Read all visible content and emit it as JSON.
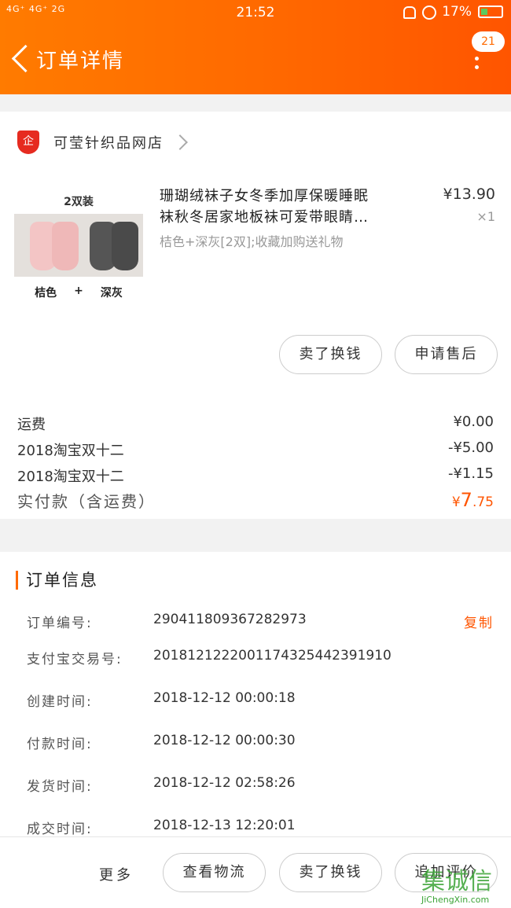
{
  "status_bar": {
    "network": "4G⁺ 4G⁺ 2G",
    "time": "21:52",
    "battery": "17%"
  },
  "header": {
    "title": "订单详情",
    "badge_count": "21"
  },
  "store": {
    "name": "可莹针织品网店"
  },
  "product": {
    "thumb_top": "2双装",
    "thumb_left": "桔色",
    "thumb_plus": "+",
    "thumb_right": "深灰",
    "title_line1": "珊瑚绒袜子女冬季加厚保暖睡眠",
    "title_line2": "袜秋冬居家地板袜可爱带眼睛…",
    "spec": "桔色+深灰[2双];收藏加购送礼物",
    "price": "¥13.90",
    "qty": "×1"
  },
  "item_actions": {
    "sell": "卖了换钱",
    "after_sale": "申请售后"
  },
  "fees": [
    {
      "label": "运费",
      "value": "¥0.00"
    },
    {
      "label": "2018淘宝双十二",
      "value": "-¥5.00"
    },
    {
      "label": "2018淘宝双十二",
      "value": "-¥1.15"
    }
  ],
  "total": {
    "label": "实付款（含运费）",
    "currency": "¥",
    "int": "7",
    "dec": ".75"
  },
  "order_info": {
    "heading": "订单信息",
    "copy_label": "复制",
    "rows": [
      {
        "label": "订单编号:",
        "value": "290411809367282973"
      },
      {
        "label": "支付宝交易号:",
        "value": "2018121222001174325442391910"
      },
      {
        "label": "创建时间:",
        "value": "2018-12-12 00:00:18"
      },
      {
        "label": "付款时间:",
        "value": "2018-12-12 00:00:30"
      },
      {
        "label": "发货时间:",
        "value": "2018-12-12 02:58:26"
      },
      {
        "label": "成交时间:",
        "value": "2018-12-13 12:20:01"
      }
    ]
  },
  "bottom_bar": {
    "more": "更多",
    "logistics": "查看物流",
    "sell": "卖了换钱",
    "review": "追加评价"
  },
  "watermark": {
    "big": "集诚信",
    "small": "JiChengXin.com"
  },
  "colors": {
    "accent": "#ff6a00",
    "price_highlight": "#ff5500"
  }
}
